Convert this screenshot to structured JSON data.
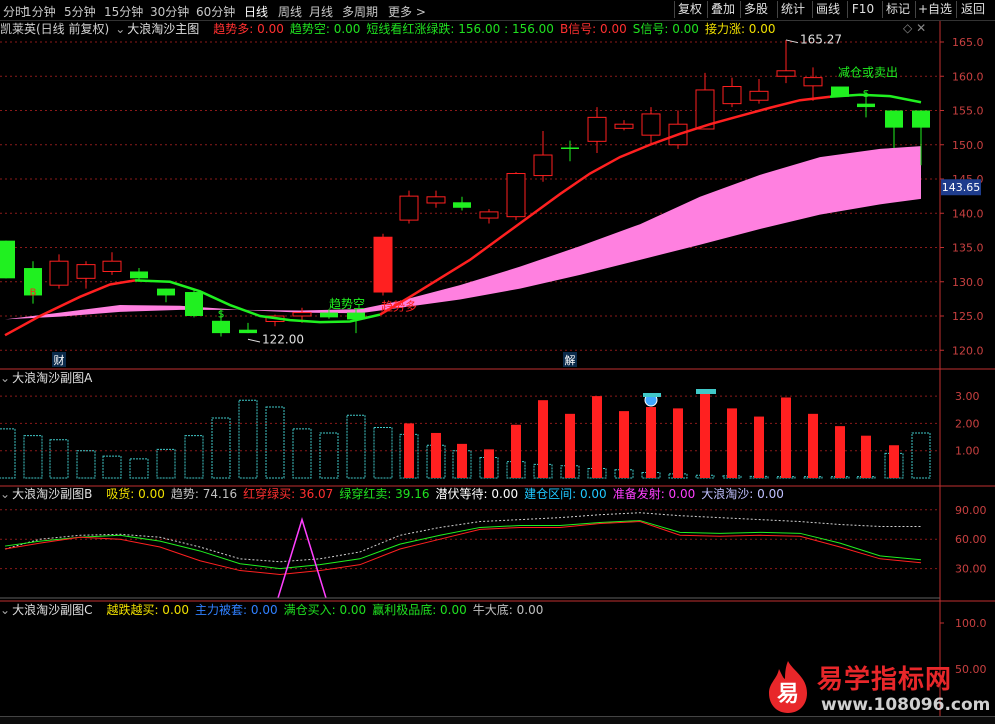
{
  "toolbar": {
    "periods": [
      "分时",
      "1分钟",
      "5分钟",
      "15分钟",
      "30分钟",
      "60分钟",
      "日线",
      "周线",
      "月线",
      "多周期",
      "更多 >"
    ],
    "active_period": "日线",
    "buttons": [
      "复权",
      "叠加",
      "多股",
      "统计",
      "画线",
      "F10",
      "标记",
      "+自选",
      "返回"
    ]
  },
  "main_panel": {
    "stock_title": "凯莱英(日线 前复权)",
    "indicator_name": "大浪淘沙主图",
    "legend": [
      {
        "text": "趋势多: 0.00",
        "color": "#ff3030"
      },
      {
        "text": "趋势空: 0.00",
        "color": "#20e020"
      },
      {
        "text": "短线看红涨绿跌: 156.00 : 156.00",
        "color": "#20e020"
      },
      {
        "text": "B信号: 0.00",
        "color": "#ff3030"
      },
      {
        "text": "S信号: 0.00",
        "color": "#20e020"
      },
      {
        "text": "接力涨: 0.00",
        "color": "#f0e000"
      }
    ],
    "y_ticks": [
      "165.0",
      "160.0",
      "155.0",
      "150.0",
      "145.0",
      "140.0",
      "135.0",
      "130.0",
      "125.0",
      "120.0"
    ],
    "current_price": "143.65",
    "annotations": {
      "high_label": "165.27",
      "low_label": "122.00",
      "trend_short": "趋势空",
      "trend_long": "趋势多",
      "reduce_sell": "减仓或卖出",
      "s_mark": "S",
      "b_mark": "B",
      "marker_cai": "财",
      "marker_jie": "解"
    }
  },
  "sub_a": {
    "title": "大浪淘沙副图A",
    "y_ticks": [
      "3.00",
      "2.00",
      "1.00"
    ]
  },
  "sub_b": {
    "title": "大浪淘沙副图B",
    "legend": [
      {
        "text": "吸货: 0.00",
        "color": "#f0e000"
      },
      {
        "text": "趋势: 74.16",
        "color": "#c0c0c0"
      },
      {
        "text": "红穿绿买: 36.07",
        "color": "#ff3030"
      },
      {
        "text": "绿穿红卖: 39.16",
        "color": "#20e020"
      },
      {
        "text": "潜伏等待: 0.00",
        "color": "#ffffff"
      },
      {
        "text": "建仓区间: 0.00",
        "color": "#20c8ff"
      },
      {
        "text": "准备发射: 0.00",
        "color": "#ff40ff"
      },
      {
        "text": "大浪淘沙: 0.00",
        "color": "#c0c0ff"
      }
    ],
    "y_ticks": [
      "90.00",
      "60.00",
      "30.00"
    ]
  },
  "sub_c": {
    "title": "大浪淘沙副图C",
    "legend": [
      {
        "text": "越跌越买: 0.00",
        "color": "#f0e000"
      },
      {
        "text": "主力被套: 0.00",
        "color": "#3080ff"
      },
      {
        "text": "满仓买入: 0.00",
        "color": "#20e020"
      },
      {
        "text": "赢利极品底: 0.00",
        "color": "#20e020"
      },
      {
        "text": "牛大底: 0.00",
        "color": "#c0c0c0"
      }
    ],
    "y_ticks": [
      "100.0",
      "50.00"
    ]
  },
  "watermark": {
    "logo_char": "易",
    "name": "易学指标网",
    "url": "www.108096.com"
  },
  "colors": {
    "up": "#ff2020",
    "down": "#20f020",
    "band": "#ff80e0",
    "grid": "#8b1a1a",
    "axis": "#c03030"
  }
}
